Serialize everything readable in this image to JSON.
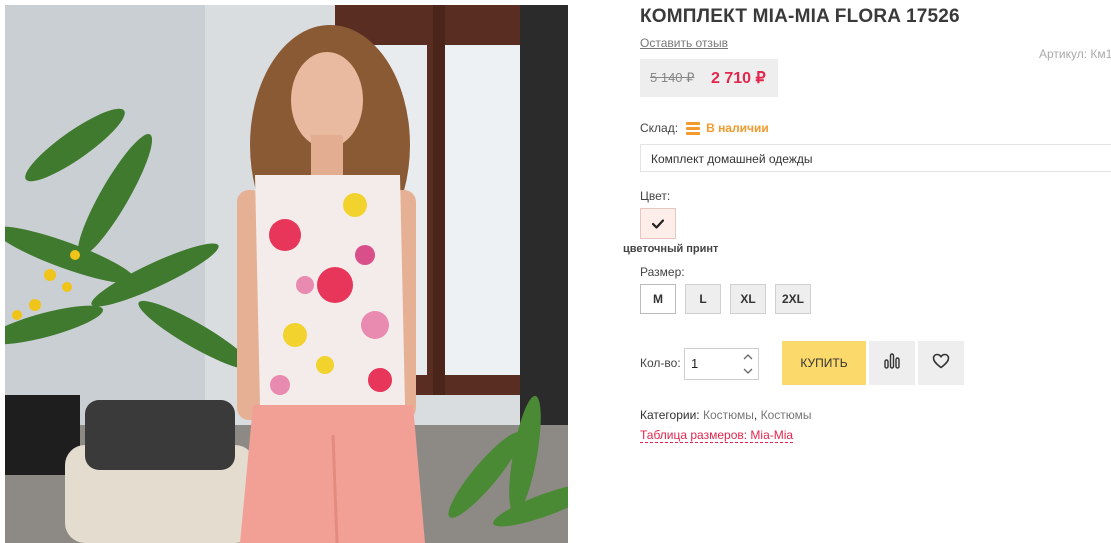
{
  "product": {
    "title": "КОМПЛЕКТ MIA-MIA FLORA 17526",
    "review_link": "Оставить отзыв",
    "article": "Артикул: Км1",
    "old_price": "5 140 ₽",
    "new_price": "2 710 ₽"
  },
  "stock": {
    "label": "Склад:",
    "value": "В наличии",
    "icon": "stock-bars-icon"
  },
  "type_field": {
    "value": "Комплект домашней одежды"
  },
  "color": {
    "label": "Цвет:",
    "selected_name": "цветочный принт",
    "icon": "checkmark-icon"
  },
  "size": {
    "label": "Размер:",
    "options": [
      "M",
      "L",
      "XL",
      "2XL"
    ],
    "selected": "M"
  },
  "quantity": {
    "label": "Кол-во:",
    "value": "1"
  },
  "buttons": {
    "buy": "КУПИТЬ",
    "compare_icon": "compare-bars-icon",
    "wishlist_icon": "heart-icon"
  },
  "categories": {
    "label": "Категории:",
    "items": [
      "Костюмы",
      "Костюмы"
    ],
    "separator": ","
  },
  "size_table_link": "Таблица размеров: Mia-Mia",
  "colors": {
    "accent_red": "#e2264d",
    "buy_yellow": "#fcd96b",
    "stock_orange": "#f39a2d"
  }
}
